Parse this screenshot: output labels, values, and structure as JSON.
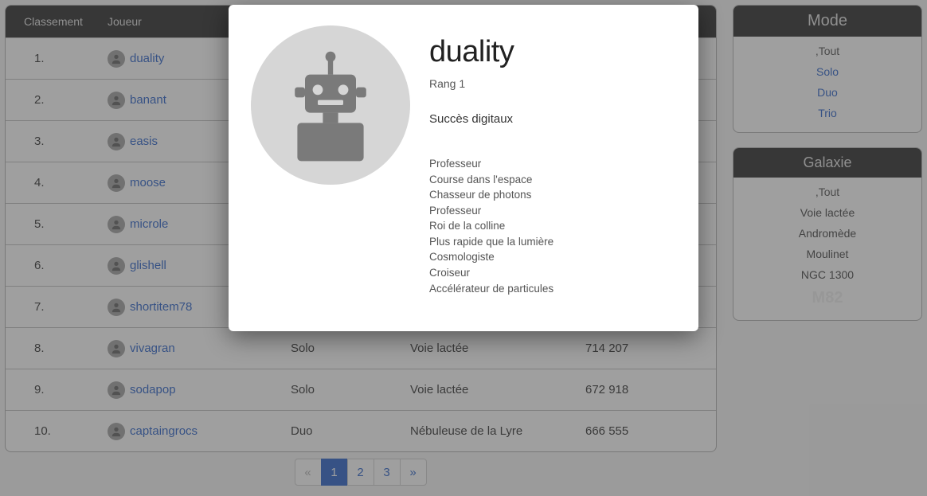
{
  "table": {
    "headers": {
      "rank": "Classement",
      "player": "Joueur",
      "mode": "",
      "galaxy": "",
      "score": ""
    },
    "rows": [
      {
        "rank": "1.",
        "player": "duality",
        "mode": "",
        "galaxy": "",
        "score": ""
      },
      {
        "rank": "2.",
        "player": "banant",
        "mode": "",
        "galaxy": "",
        "score": ""
      },
      {
        "rank": "3.",
        "player": "easis",
        "mode": "",
        "galaxy": "",
        "score": ""
      },
      {
        "rank": "4.",
        "player": "moose",
        "mode": "",
        "galaxy": "",
        "score": ""
      },
      {
        "rank": "5.",
        "player": "microle",
        "mode": "",
        "galaxy": "",
        "score": ""
      },
      {
        "rank": "6.",
        "player": "glishell",
        "mode": "",
        "galaxy": "",
        "score": ""
      },
      {
        "rank": "7.",
        "player": "shortitem78",
        "mode": "",
        "galaxy": "",
        "score": ""
      },
      {
        "rank": "8.",
        "player": "vivagran",
        "mode": "Solo",
        "galaxy": "Voie lactée",
        "score": "714 207"
      },
      {
        "rank": "9.",
        "player": "sodapop",
        "mode": "Solo",
        "galaxy": "Voie lactée",
        "score": "672 918"
      },
      {
        "rank": "10.",
        "player": "captaingrocs",
        "mode": "Duo",
        "galaxy": "Nébuleuse de la Lyre",
        "score": "666 555"
      }
    ]
  },
  "pagination": {
    "prev": "«",
    "p1": "1",
    "p2": "2",
    "p3": "3",
    "next": "»"
  },
  "mode_card": {
    "title": "Mode",
    "items": [
      {
        "label": "Tout",
        "kind": "sel",
        "prefix": ","
      },
      {
        "label": "Solo",
        "kind": "link"
      },
      {
        "label": "Duo",
        "kind": "link"
      },
      {
        "label": "Trio",
        "kind": "link"
      }
    ]
  },
  "galaxy_card": {
    "title": "Galaxie",
    "items": [
      {
        "label": "Tout",
        "kind": "sel",
        "prefix": ","
      },
      {
        "label": "Voie lactée",
        "kind": "plain"
      },
      {
        "label": "Andromède",
        "kind": "plain"
      },
      {
        "label": "Moulinet",
        "kind": "plain"
      },
      {
        "label": "NGC 1300",
        "kind": "plain"
      },
      {
        "label": "M82",
        "kind": "bold"
      }
    ]
  },
  "modal": {
    "name": "duality",
    "rank": "Rang 1",
    "success_title": "Succès digitaux",
    "achievements": [
      "Professeur",
      "Course dans l'espace",
      "Chasseur de photons",
      "Professeur",
      "Roi de la colline",
      "Plus rapide que la lumière",
      "Cosmologiste",
      "Croiseur",
      "Accélérateur de particules"
    ]
  }
}
